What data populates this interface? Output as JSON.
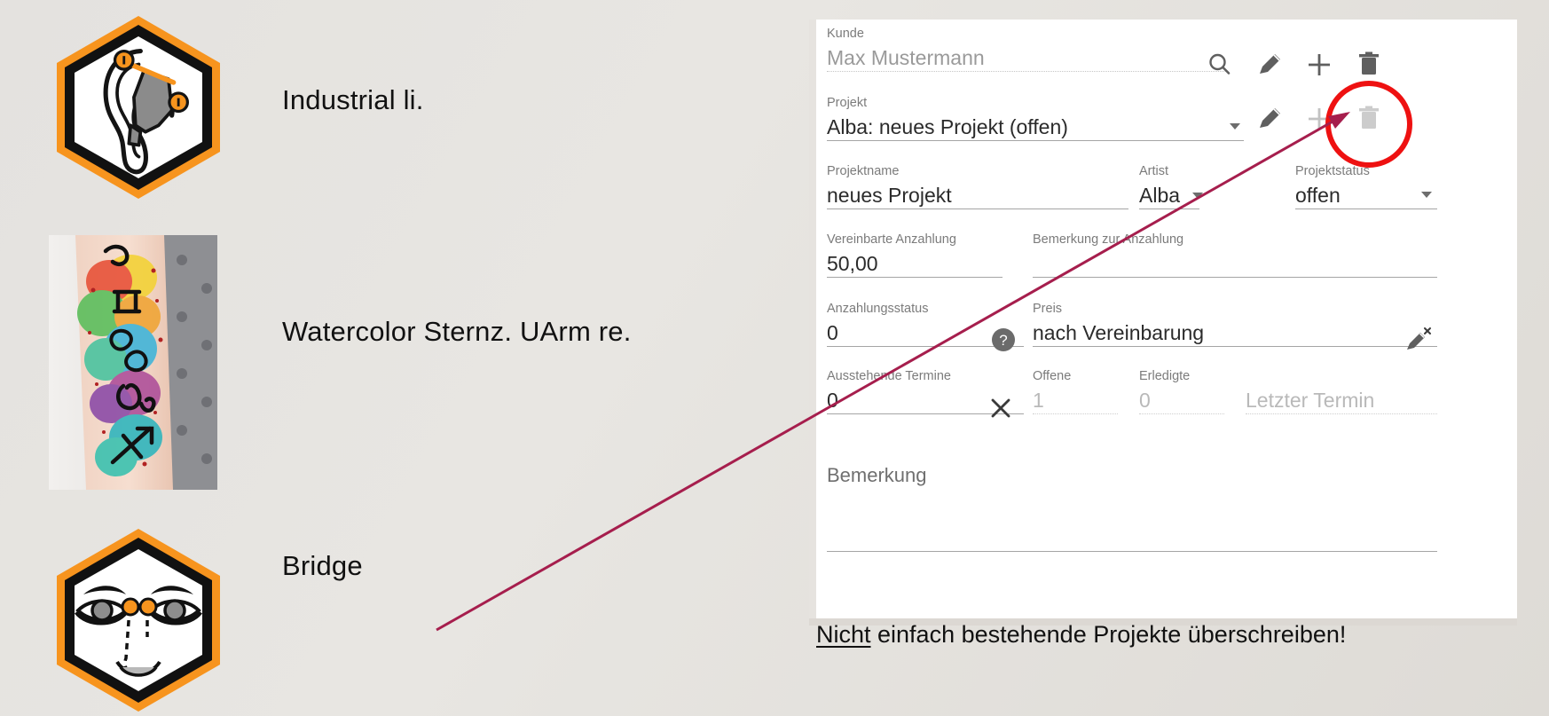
{
  "left_panel": {
    "items": [
      {
        "icon": "ear-industrial-piercing-icon",
        "label": "Industrial li."
      },
      {
        "icon": "watercolor-zodiac-tattoo-photo",
        "label": "Watercolor Sternz. UArm re."
      },
      {
        "icon": "face-bridge-piercing-icon",
        "label": "Bridge"
      }
    ]
  },
  "form": {
    "kunde": {
      "label": "Kunde",
      "value": "Max Mustermann",
      "actions": [
        "search-icon",
        "edit-icon",
        "add-icon",
        "delete-icon"
      ]
    },
    "projekt": {
      "label": "Projekt",
      "value": "Alba: neues Projekt (offen)",
      "actions": [
        "edit-icon",
        "add-icon",
        "delete-icon"
      ]
    },
    "projektname": {
      "label": "Projektname",
      "value": "neues Projekt"
    },
    "artist": {
      "label": "Artist",
      "value": "Alba"
    },
    "projektstatus": {
      "label": "Projektstatus",
      "value": "offen"
    },
    "vereinbarte_anzahlung": {
      "label": "Vereinbarte Anzahlung",
      "value": "50,00"
    },
    "bemerkung_zur_anzahlung": {
      "label": "Bemerkung zur Anzahlung",
      "value": ""
    },
    "anzahlungsstatus": {
      "label": "Anzahlungsstatus",
      "value": "0",
      "help": "help-icon"
    },
    "preis": {
      "label": "Preis",
      "value": "nach Vereinbarung",
      "action": "edit-clear-icon"
    },
    "ausstehende_termine": {
      "label": "Ausstehende Termine",
      "value": "0",
      "action": "clear-icon"
    },
    "offene": {
      "label": "Offene",
      "value": "1"
    },
    "erledigte": {
      "label": "Erledigte",
      "value": "0"
    },
    "letzter_termin": {
      "label": "",
      "value": "Letzter Termin"
    },
    "bemerkung": {
      "label": "Bemerkung",
      "value": ""
    }
  },
  "warning": {
    "emphasis": "Nicht",
    "rest": " einfach bestehende Projekte überschreiben!"
  },
  "colors": {
    "accent_orange": "#f7941e",
    "annotation_red": "#a61e4d",
    "circle_red": "#ee1111",
    "panel_bg": "#ffffff",
    "page_bg": "#e4e2df",
    "label_grey": "#7b7b7b",
    "value_dark": "#2b2b2b"
  }
}
